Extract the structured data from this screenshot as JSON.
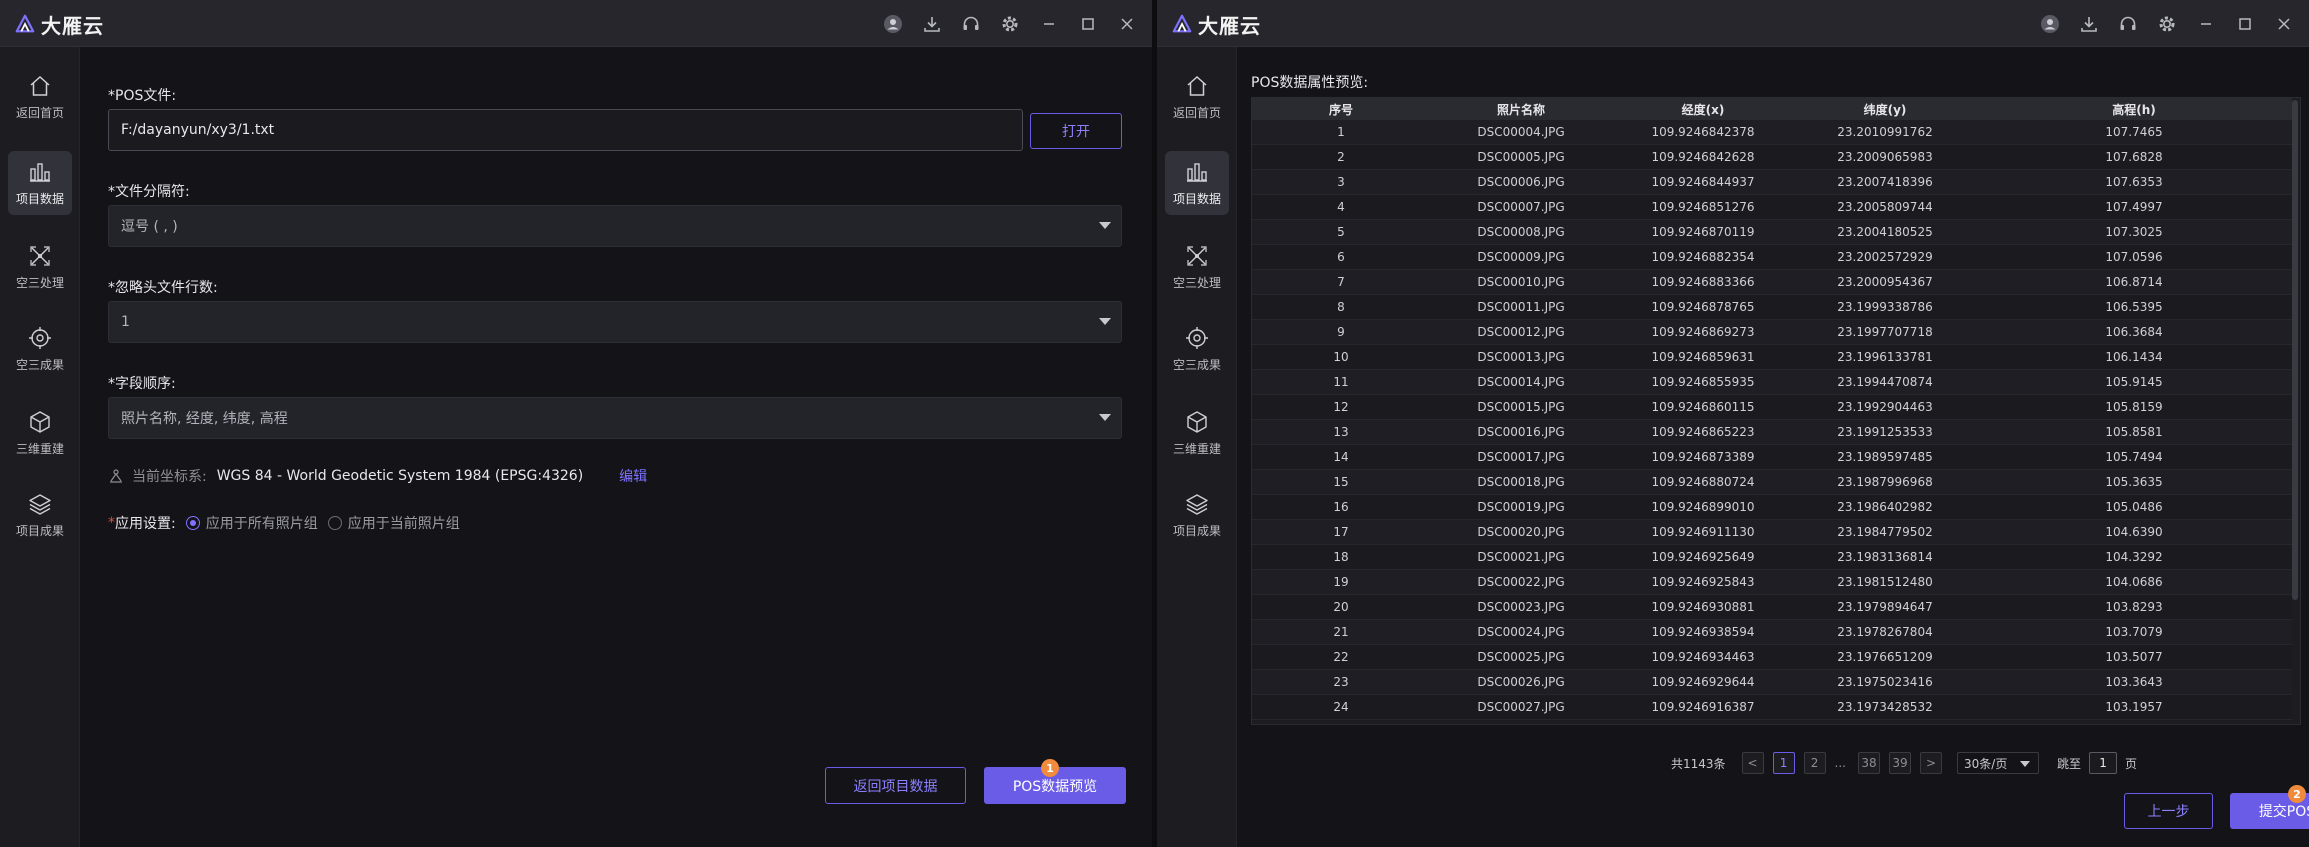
{
  "app": {
    "brand": "大雁云",
    "colors": {
      "accent": "#6a5ce6",
      "badge": "#f08a3c",
      "background": "#141418"
    }
  },
  "titlebar_icons": [
    "user-icon",
    "download-icon",
    "headset-icon",
    "gear-icon",
    "minimize-icon",
    "maximize-icon",
    "close-icon"
  ],
  "sidebar": {
    "items": [
      {
        "label": "返回首页",
        "icon": "home-icon"
      },
      {
        "label": "项目数据",
        "icon": "bar-chart-icon"
      },
      {
        "label": "空三处理",
        "icon": "aerial-triangulation-icon"
      },
      {
        "label": "空三成果",
        "icon": "aerial-result-icon"
      },
      {
        "label": "三维重建",
        "icon": "cube-icon"
      },
      {
        "label": "项目成果",
        "icon": "layers-icon"
      }
    ]
  },
  "left": {
    "pos_file": {
      "label": "*POS文件:",
      "value": "F:/dayanyun/xy3/1.txt",
      "open_button": "打开"
    },
    "separator": {
      "label": "*文件分隔符:",
      "value": "逗号 ( , )"
    },
    "skip_rows": {
      "label": "*忽略头文件行数:",
      "value": "1"
    },
    "field_order": {
      "label": "*字段顺序:",
      "value": "照片名称, 经度, 纬度, 高程"
    },
    "coord": {
      "label": "当前坐标系:",
      "value": "WGS 84 - World Geodetic System 1984 (EPSG:4326)",
      "edit": "编辑"
    },
    "apply": {
      "asterisk": "*",
      "label": "应用设置:",
      "options": [
        "应用于所有照片组",
        "应用于当前照片组"
      ],
      "selected": 0
    },
    "buttons": {
      "back": "返回项目数据",
      "preview": "POS数据预览",
      "preview_badge": "1"
    }
  },
  "right": {
    "title": "POS数据属性预览:",
    "columns": [
      "序号",
      "照片名称",
      "经度(x)",
      "纬度(y)",
      "高程(h)"
    ],
    "rows": [
      [
        "1",
        "DSC00004.JPG",
        "109.9246842378",
        "23.2010991762",
        "107.7465"
      ],
      [
        "2",
        "DSC00005.JPG",
        "109.9246842628",
        "23.2009065983",
        "107.6828"
      ],
      [
        "3",
        "DSC00006.JPG",
        "109.9246844937",
        "23.2007418396",
        "107.6353"
      ],
      [
        "4",
        "DSC00007.JPG",
        "109.9246851276",
        "23.2005809744",
        "107.4997"
      ],
      [
        "5",
        "DSC00008.JPG",
        "109.9246870119",
        "23.2004180525",
        "107.3025"
      ],
      [
        "6",
        "DSC00009.JPG",
        "109.9246882354",
        "23.2002572929",
        "107.0596"
      ],
      [
        "7",
        "DSC00010.JPG",
        "109.9246883366",
        "23.2000954367",
        "106.8714"
      ],
      [
        "8",
        "DSC00011.JPG",
        "109.9246878765",
        "23.1999338786",
        "106.5395"
      ],
      [
        "9",
        "DSC00012.JPG",
        "109.9246869273",
        "23.1997707718",
        "106.3684"
      ],
      [
        "10",
        "DSC00013.JPG",
        "109.9246859631",
        "23.1996133781",
        "106.1434"
      ],
      [
        "11",
        "DSC00014.JPG",
        "109.9246855935",
        "23.1994470874",
        "105.9145"
      ],
      [
        "12",
        "DSC00015.JPG",
        "109.9246860115",
        "23.1992904463",
        "105.8159"
      ],
      [
        "13",
        "DSC00016.JPG",
        "109.9246865223",
        "23.1991253533",
        "105.8581"
      ],
      [
        "14",
        "DSC00017.JPG",
        "109.9246873389",
        "23.1989597485",
        "105.7494"
      ],
      [
        "15",
        "DSC00018.JPG",
        "109.9246880724",
        "23.1987996968",
        "105.3635"
      ],
      [
        "16",
        "DSC00019.JPG",
        "109.9246899010",
        "23.1986402982",
        "105.0486"
      ],
      [
        "17",
        "DSC00020.JPG",
        "109.9246911130",
        "23.1984779502",
        "104.6390"
      ],
      [
        "18",
        "DSC00021.JPG",
        "109.9246925649",
        "23.1983136814",
        "104.3292"
      ],
      [
        "19",
        "DSC00022.JPG",
        "109.9246925843",
        "23.1981512480",
        "104.0686"
      ],
      [
        "20",
        "DSC00023.JPG",
        "109.9246930881",
        "23.1979894647",
        "103.8293"
      ],
      [
        "21",
        "DSC00024.JPG",
        "109.9246938594",
        "23.1978267804",
        "103.7079"
      ],
      [
        "22",
        "DSC00025.JPG",
        "109.9246934463",
        "23.1976651209",
        "103.5077"
      ],
      [
        "23",
        "DSC00026.JPG",
        "109.9246929644",
        "23.1975023416",
        "103.3643"
      ],
      [
        "24",
        "DSC00027.JPG",
        "109.9246916387",
        "23.1973428532",
        "103.1957"
      ]
    ],
    "pagination": {
      "total": "共1143条",
      "prev": "<",
      "pages": [
        "1",
        "2"
      ],
      "ellipsis": "...",
      "last_pages": [
        "38",
        "39"
      ],
      "next": ">",
      "page_size": "30条/页",
      "jump_prefix": "跳至",
      "jump_value": "1",
      "jump_suffix": "页"
    },
    "buttons": {
      "prev_step": "上一步",
      "submit": "提交POS文件",
      "submit_badge": "2"
    }
  }
}
